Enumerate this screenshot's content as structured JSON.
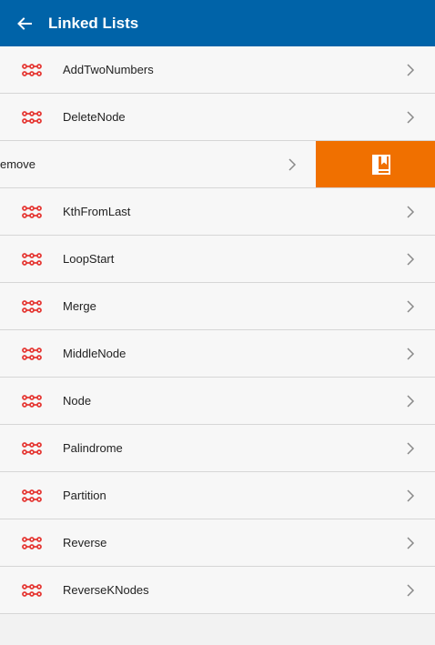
{
  "toolbar": {
    "title": "Linked Lists",
    "back_icon": "arrow-left-icon",
    "background_color": "#0063a8"
  },
  "list": {
    "item_icon": "linked-list-icon",
    "item_icon_color": "#e53935",
    "chevron_icon": "chevron-right-icon",
    "items": [
      {
        "label": "AddTwoNumbers"
      },
      {
        "label": "DeleteNode"
      },
      {
        "label": "emove",
        "swiped": true,
        "action_icon": "bookmark-book-icon",
        "action_color": "#f07000"
      },
      {
        "label": "KthFromLast"
      },
      {
        "label": "LoopStart"
      },
      {
        "label": "Merge"
      },
      {
        "label": "MiddleNode"
      },
      {
        "label": "Node"
      },
      {
        "label": "Palindrome"
      },
      {
        "label": "Partition"
      },
      {
        "label": "Reverse"
      },
      {
        "label": "ReverseKNodes"
      }
    ]
  }
}
